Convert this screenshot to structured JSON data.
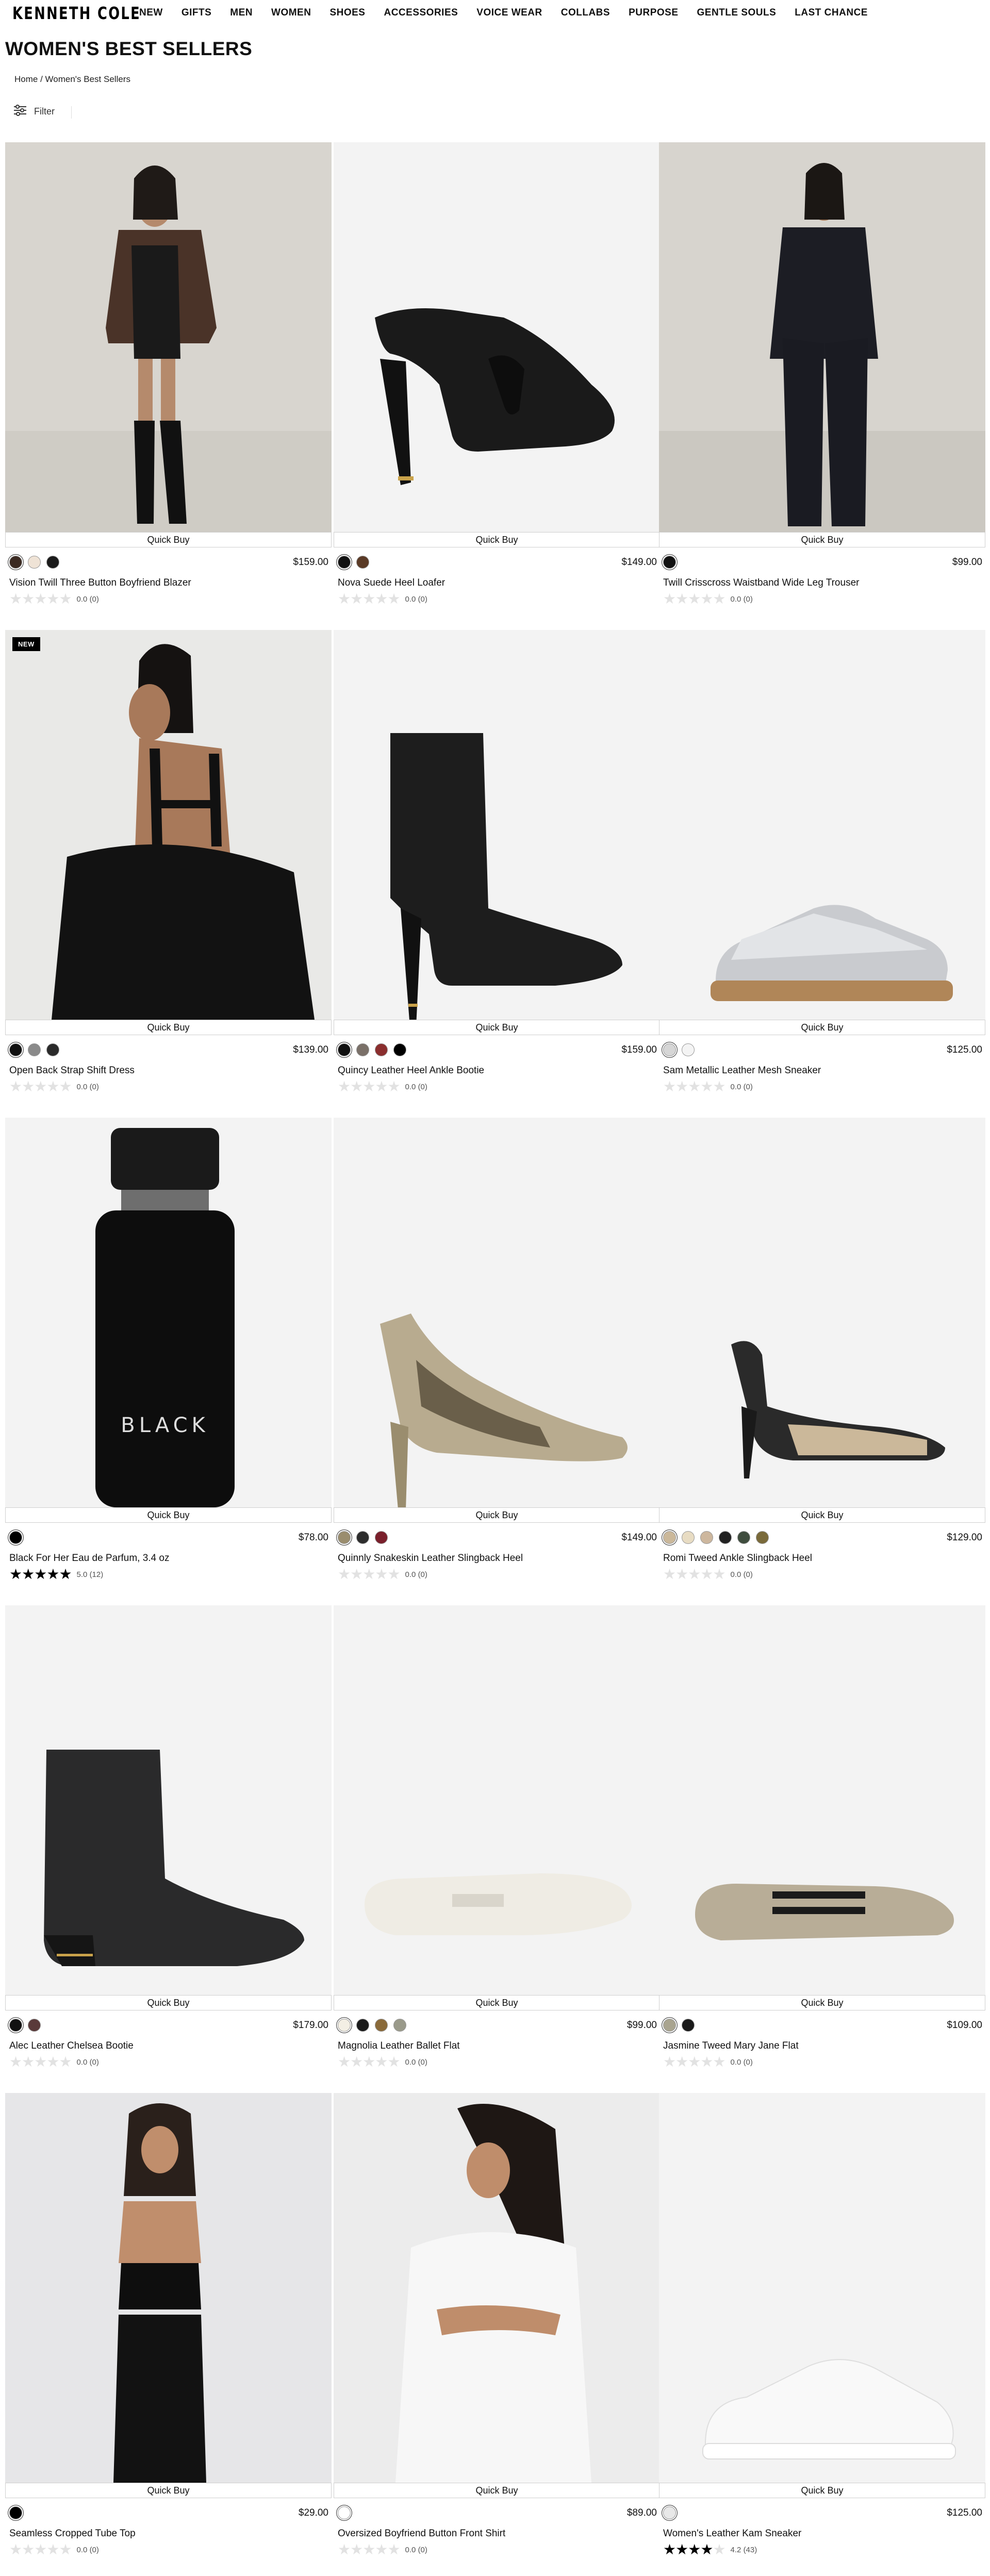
{
  "header": {
    "logo": "KENNETH COLE",
    "nav": [
      "NEW",
      "GIFTS",
      "MEN",
      "WOMEN",
      "SHOES",
      "ACCESSORIES",
      "VOICE WEAR",
      "COLLABS",
      "PURPOSE",
      "GENTLE SOULS",
      "LAST CHANCE"
    ]
  },
  "page": {
    "title": "WOMEN'S BEST SELLERS",
    "breadcrumb_home": "Home",
    "breadcrumb_sep": " / ",
    "breadcrumb_current": "Women's Best Sellers",
    "filter_label": "Filter",
    "quick_buy_label": "Quick Buy"
  },
  "products": [
    {
      "name": "Vision Twill Three Button Boyfriend Blazer",
      "price": "$159.00",
      "rating": "0.0 (0)",
      "stars": 0,
      "swatches": [
        "#3b2a22",
        "#efe3d6",
        "#1b1b1b"
      ],
      "image": "blazer-model"
    },
    {
      "name": "Nova Suede Heel Loafer",
      "price": "$149.00",
      "rating": "0.0 (0)",
      "stars": 0,
      "swatches": [
        "#111111",
        "#5a3a26"
      ],
      "image": "black-heel-loafer"
    },
    {
      "name": "Twill Crisscross Waistband Wide Leg Trouser",
      "price": "$99.00",
      "rating": "0.0 (0)",
      "stars": 0,
      "swatches": [
        "#111111"
      ],
      "image": "trouser-model"
    },
    {
      "name": "Open Back Strap Shift Dress",
      "price": "$139.00",
      "rating": "0.0 (0)",
      "stars": 0,
      "swatches": [
        "#111111",
        "#8a8a8a",
        "#2a2a2a"
      ],
      "image": "dress-model",
      "badge": "NEW"
    },
    {
      "name": "Quincy Leather Heel Ankle Bootie",
      "price": "$159.00",
      "rating": "0.0 (0)",
      "stars": 0,
      "swatches": [
        "#111111",
        "#7a7068",
        "#8b2e2e",
        "#000000"
      ],
      "image": "ankle-bootie"
    },
    {
      "name": "Sam Metallic Leather Mesh Sneaker",
      "price": "$125.00",
      "rating": "0.0 (0)",
      "stars": 0,
      "swatches": [
        "#d6d6d6",
        "#f4f4f4"
      ],
      "image": "metallic-sneaker"
    },
    {
      "name": "Black For Her Eau de Parfum, 3.4 oz",
      "price": "$78.00",
      "rating": "5.0 (12)",
      "stars": 5,
      "swatches": [
        "#000000"
      ],
      "image": "perfume-bottle"
    },
    {
      "name": "Quinnly Snakeskin Leather Slingback Heel",
      "price": "$149.00",
      "rating": "0.0 (0)",
      "stars": 0,
      "swatches": [
        "#9a8d6e",
        "#2d2d2d",
        "#7a1f2b"
      ],
      "image": "snakeskin-slingback"
    },
    {
      "name": "Romi Tweed Ankle Slingback Heel",
      "price": "$129.00",
      "rating": "0.0 (0)",
      "stars": 0,
      "swatches": [
        "#cbb89a",
        "#e8dcc3",
        "#cdb79e",
        "#222222",
        "#3f4d3e",
        "#7a6a3a"
      ],
      "image": "tweed-slingback"
    },
    {
      "name": "Alec Leather Chelsea Bootie",
      "price": "$179.00",
      "rating": "0.0 (0)",
      "stars": 0,
      "swatches": [
        "#111111",
        "#5a3a3a"
      ],
      "image": "chelsea-bootie"
    },
    {
      "name": "Magnolia Leather Ballet Flat",
      "price": "$99.00",
      "rating": "0.0 (0)",
      "stars": 0,
      "swatches": [
        "#f3efe4",
        "#1a1a1a",
        "#8a6a3a",
        "#9a9a8a"
      ],
      "image": "ballet-flat"
    },
    {
      "name": "Jasmine Tweed Mary Jane Flat",
      "price": "$109.00",
      "rating": "0.0 (0)",
      "stars": 0,
      "swatches": [
        "#a9a48f",
        "#1a1a1a"
      ],
      "image": "tweed-mary-jane"
    },
    {
      "name": "Seamless Cropped Tube Top",
      "price": "$29.00",
      "rating": "0.0 (0)",
      "stars": 0,
      "swatches": [
        "#000000"
      ],
      "image": "tube-top-model"
    },
    {
      "name": "Oversized Boyfriend Button Front Shirt",
      "price": "$89.00",
      "rating": "0.0 (0)",
      "stars": 0,
      "swatches": [
        "#ffffff"
      ],
      "image": "shirt-model"
    },
    {
      "name": "Women's Leather Kam Sneaker",
      "price": "$125.00",
      "rating": "4.2 (43)",
      "stars": 4,
      "swatches": [
        "#e8e8e8"
      ],
      "image": "white-sneaker"
    }
  ]
}
